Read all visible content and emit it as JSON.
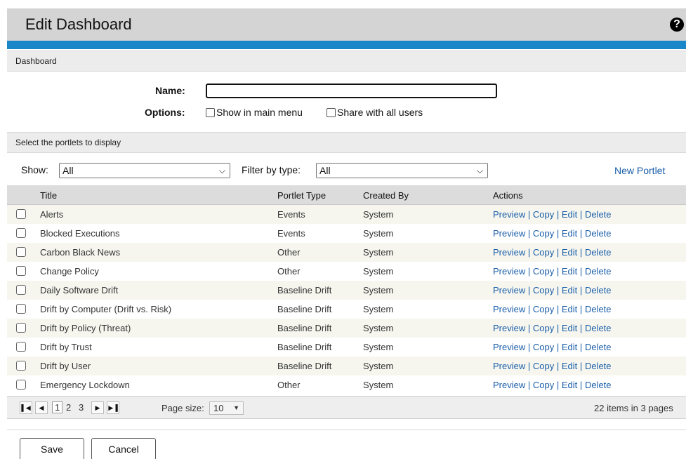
{
  "header": {
    "title": "Edit Dashboard",
    "help_glyph": "?"
  },
  "dashboard_section": {
    "heading": "Dashboard",
    "name_label": "Name:",
    "name_value": "",
    "options_label": "Options:",
    "option_main_menu": "Show in main menu",
    "option_share": "Share with all users"
  },
  "portlets_section": {
    "heading": "Select the portlets to display",
    "show_label": "Show:",
    "show_value": "All",
    "filter_label": "Filter by type:",
    "filter_value": "All",
    "new_portlet_link": "New Portlet"
  },
  "grid": {
    "columns": [
      "Title",
      "Portlet Type",
      "Created By",
      "Actions"
    ],
    "rows": [
      {
        "title": "Alerts",
        "type": "Events",
        "created_by": "System"
      },
      {
        "title": "Blocked Executions",
        "type": "Events",
        "created_by": "System"
      },
      {
        "title": "Carbon Black News",
        "type": "Other",
        "created_by": "System"
      },
      {
        "title": "Change Policy",
        "type": "Other",
        "created_by": "System"
      },
      {
        "title": "Daily Software Drift",
        "type": "Baseline Drift",
        "created_by": "System"
      },
      {
        "title": "Drift by Computer (Drift vs. Risk)",
        "type": "Baseline Drift",
        "created_by": "System"
      },
      {
        "title": "Drift by Policy (Threat)",
        "type": "Baseline Drift",
        "created_by": "System"
      },
      {
        "title": "Drift by Trust",
        "type": "Baseline Drift",
        "created_by": "System"
      },
      {
        "title": "Drift by User",
        "type": "Baseline Drift",
        "created_by": "System"
      },
      {
        "title": "Emergency Lockdown",
        "type": "Other",
        "created_by": "System"
      }
    ],
    "actions": {
      "preview": "Preview",
      "copy": "Copy",
      "edit": "Edit",
      "delete": "Delete",
      "separator": "|"
    }
  },
  "pager": {
    "first_glyph": "⏮",
    "pages": [
      "1",
      "2",
      "3"
    ],
    "current_page": "1",
    "page_size_label": "Page size:",
    "page_size_value": "10",
    "items_info": "22 items in 3 pages"
  },
  "footer": {
    "save_label": "Save",
    "cancel_label": "Cancel"
  }
}
